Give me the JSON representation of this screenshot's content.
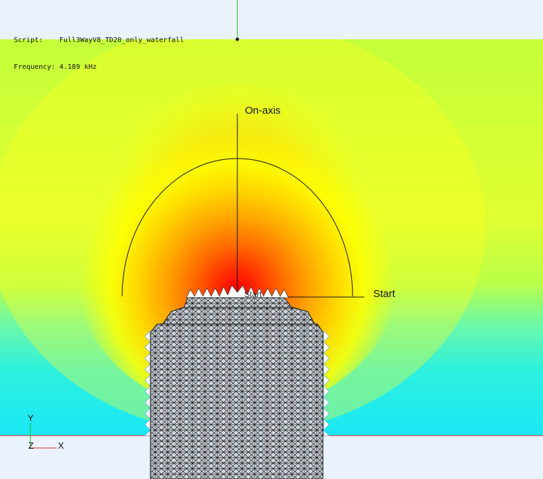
{
  "info": {
    "script_label": "Script:",
    "script_value": "Full3WayV8_TD20_only_waterfall",
    "frequency_label": "Frequency:",
    "frequency_value": "4.189 kHz"
  },
  "overlay": {
    "on_axis_label": "On-axis",
    "start_label": "Start",
    "start_label_small": "Start"
  },
  "axes": {
    "y": "Y",
    "z": "Z",
    "x": "X"
  },
  "colors": {
    "background": "#eaf3fb",
    "field_outer": "#c8ff40",
    "field_mid": "#ffff00",
    "field_hot": "#ff0000",
    "field_low": "#20f0e0",
    "mesh_fill": "#cdd4dc",
    "mesh_line": "#1a1a1a",
    "axis_x": "#e02020",
    "axis_y": "#10c010"
  }
}
